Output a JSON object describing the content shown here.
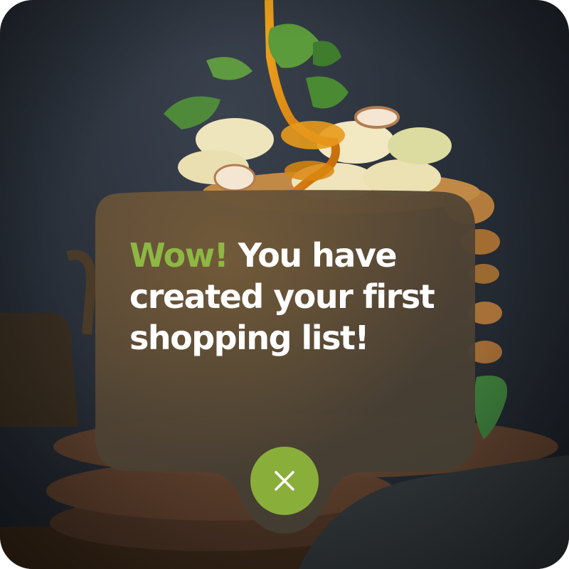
{
  "popup": {
    "headline_accent": "Wow!",
    "headline_rest": " You have created your first shopping list!",
    "close_icon": "close-icon"
  },
  "colors": {
    "accent": "#8db843",
    "close_button": "#8aae3a",
    "text": "#ffffff",
    "popup_background": "#4a3f30"
  }
}
